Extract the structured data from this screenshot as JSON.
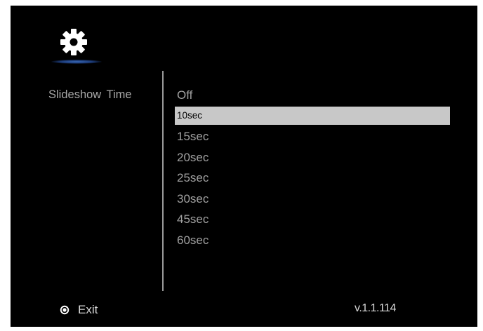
{
  "header": {
    "icon": "gear-icon"
  },
  "setting": {
    "label": "Slideshow Time"
  },
  "options": [
    {
      "label": "Off"
    },
    {
      "label": "10sec",
      "selected": true
    },
    {
      "label": "15sec"
    },
    {
      "label": "20sec"
    },
    {
      "label": "25sec"
    },
    {
      "label": "30sec"
    },
    {
      "label": "45sec"
    },
    {
      "label": "60sec"
    }
  ],
  "footer": {
    "exit_icon": "remote-button-icon",
    "exit_label": "Exit",
    "version": "v.1.1.114"
  },
  "colors": {
    "background": "#000000",
    "selected_highlight": "#c8c8c8",
    "text_dim": "#a0a0a0",
    "accent_glow": "#3a6ab8"
  }
}
